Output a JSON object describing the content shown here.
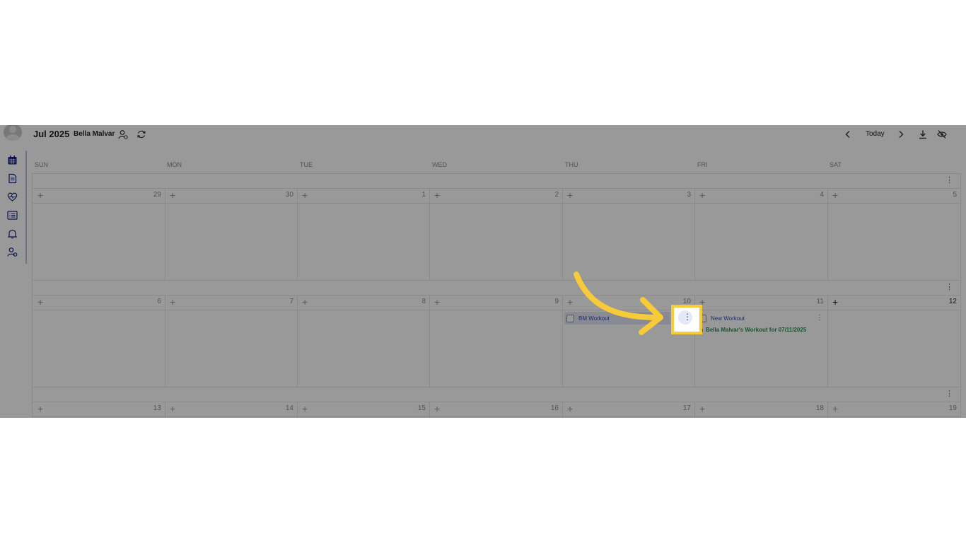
{
  "header": {
    "month_year": "Jul 2025",
    "client_name": "Bella Malvar",
    "today_label": "Today",
    "icons": [
      "assign-user-icon",
      "refresh-icon",
      "prev-chevron-icon",
      "next-chevron-icon",
      "download-icon",
      "hide-icon"
    ]
  },
  "sidebar": {
    "icons": [
      "calendar-icon",
      "document-icon",
      "heart-pulse-icon",
      "list-icon",
      "bell-icon",
      "user-settings-icon"
    ]
  },
  "calendar": {
    "weekdays": [
      "SUN",
      "MON",
      "TUE",
      "WED",
      "THU",
      "FRI",
      "SAT"
    ],
    "weeks": [
      {
        "days": [
          "29",
          "30",
          "1",
          "2",
          "3",
          "4",
          "5"
        ]
      },
      {
        "days": [
          "6",
          "7",
          "8",
          "9",
          "10",
          "11",
          "12"
        ]
      },
      {
        "days": [
          "13",
          "14",
          "15",
          "16",
          "17",
          "18",
          "19"
        ]
      }
    ],
    "events": {
      "thu_workout": "BM Workout",
      "fri_workout": "New Workout",
      "fri_completed": "Bella Malvar's Workout for 07/11/2025"
    }
  },
  "colors": {
    "highlight": "#f7ca39",
    "event_text": "#3949ab",
    "completed": "#2e8b57",
    "overlay": "rgba(0,0,0,0.40)"
  }
}
